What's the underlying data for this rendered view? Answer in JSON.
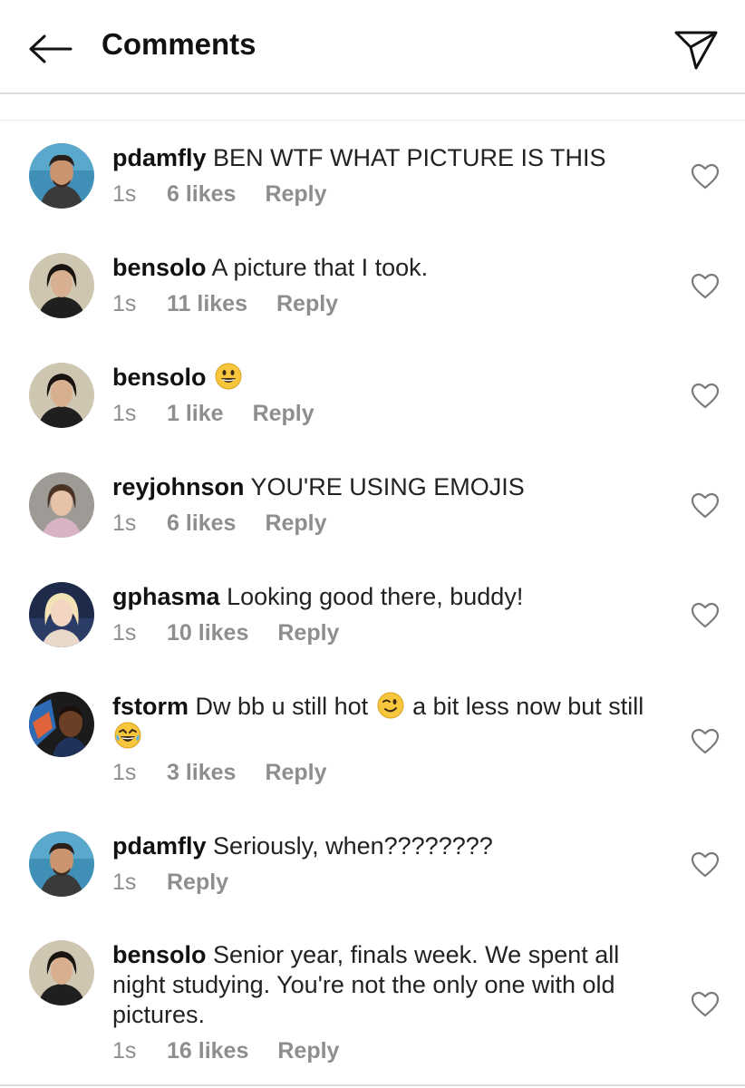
{
  "header": {
    "title": "Comments"
  },
  "comments": [
    {
      "username": "pdamfly",
      "text": "BEN WTF WHAT PICTURE IS THIS",
      "time": "1s",
      "likes": "6 likes",
      "reply": "Reply",
      "avatar": "avatar-pdamfly"
    },
    {
      "username": "bensolo",
      "text": "A picture that I took.",
      "time": "1s",
      "likes": "11 likes",
      "reply": "Reply",
      "avatar": "avatar-bensolo"
    },
    {
      "username": "bensolo",
      "text": "",
      "emoji": "grinning-face-emoji",
      "time": "1s",
      "likes": "1 like",
      "reply": "Reply",
      "avatar": "avatar-bensolo"
    },
    {
      "username": "reyjohnson",
      "text": "YOU'RE USING EMOJIS",
      "time": "1s",
      "likes": "6 likes",
      "reply": "Reply",
      "avatar": "avatar-reyjohnson"
    },
    {
      "username": "gphasma",
      "text": "Looking good there, buddy!",
      "time": "1s",
      "likes": "10 likes",
      "reply": "Reply",
      "avatar": "avatar-gphasma"
    },
    {
      "username": "fstorm",
      "text_part1": "Dw bb u still hot",
      "text_part2": "a bit less now but still",
      "emoji1": "winking-face-emoji",
      "emoji2": "laughing-face-emoji",
      "time": "1s",
      "likes": "3 likes",
      "reply": "Reply",
      "avatar": "avatar-fstorm"
    },
    {
      "username": "pdamfly",
      "text": "Seriously, when????????",
      "time": "1s",
      "likes": "",
      "reply": "Reply",
      "avatar": "avatar-pdamfly"
    },
    {
      "username": "bensolo",
      "text": "Senior year, finals week. We spent all night studying. You're not the only one with old pictures.",
      "time": "1s",
      "likes": "16 likes",
      "reply": "Reply",
      "avatar": "avatar-bensolo"
    }
  ],
  "icons": {
    "back": "arrow-left-icon",
    "send": "paper-plane-icon",
    "like": "heart-outline-icon"
  },
  "colors": {
    "meta_gray": "#8e8e8e",
    "divider": "#dcdcdc",
    "emoji_yellow": "#f7c63c"
  }
}
